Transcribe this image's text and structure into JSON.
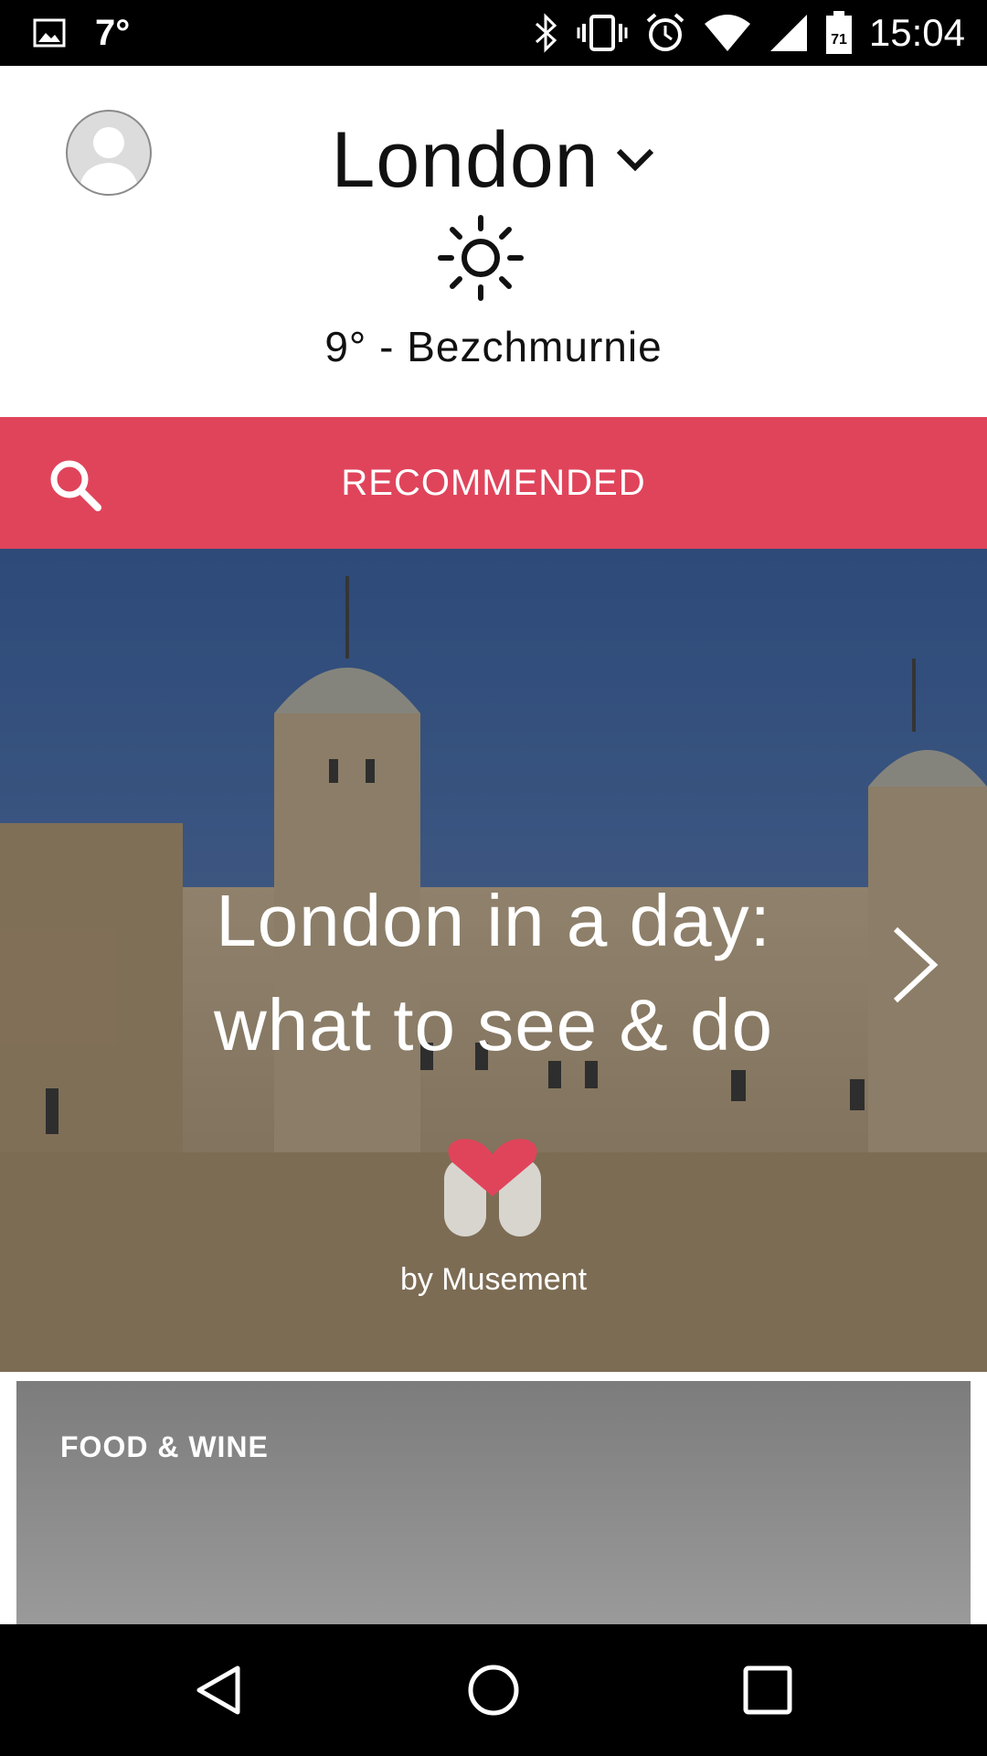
{
  "status_bar": {
    "temperature": "7°",
    "time": "15:04",
    "battery_level": "71",
    "icons": [
      "image-icon",
      "bluetooth-icon",
      "vibrate-icon",
      "alarm-icon",
      "wifi-icon",
      "signal-icon",
      "battery-icon"
    ]
  },
  "header": {
    "city": "London",
    "weather_icon": "sun-icon",
    "weather_text": "9° - Bezchmurnie"
  },
  "recommended_bar": {
    "label": "RECOMMENDED",
    "search_icon": "search-icon",
    "accent_color": "#e0445b"
  },
  "hero": {
    "title_line1": "London in a day:",
    "title_line2": "what to see & do",
    "byline": "by Musement"
  },
  "card": {
    "title": "FOOD & WINE"
  },
  "nav_bar": {
    "buttons": [
      "back-icon",
      "home-icon",
      "recents-icon"
    ]
  }
}
